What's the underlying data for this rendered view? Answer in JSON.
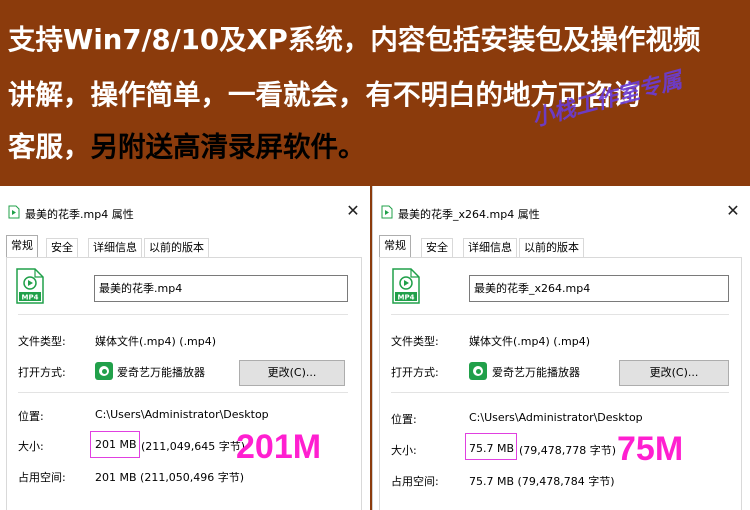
{
  "banner": {
    "line1": "支持Win7/8/10及XP系统，内容包括安装包及操作视频",
    "line2": "讲解，操作简单，一看就会，有不明白的地方可咨询",
    "line3_a": "客服，",
    "line3_b": "另附送高清录屏软件。",
    "watermark": "小栈工作室专属",
    "bg_color": "#8b3b0c"
  },
  "left_dialog": {
    "title": "最美的花季.mp4 属性",
    "close": "✕",
    "tabs": [
      "常规",
      "安全",
      "详细信息",
      "以前的版本"
    ],
    "file_name": "最美的花季.mp4",
    "file_type_label": "文件类型:",
    "file_type_value": "媒体文件(.mp4) (.mp4)",
    "open_with_label": "打开方式:",
    "open_with_value": "爱奇艺万能播放器",
    "change_button": "更改(C)...",
    "location_label": "位置:",
    "location_value": "C:\\Users\\Administrator\\Desktop",
    "size_label": "大小:",
    "size_value_hl": "201 MB",
    "size_value_rest": "(211,049,645 字节)",
    "disk_label": "占用空间:",
    "disk_value": "201 MB (211,050,496 字节)",
    "annotation": "201M"
  },
  "right_dialog": {
    "title": "最美的花季_x264.mp4 属性",
    "close": "✕",
    "tabs": [
      "常规",
      "安全",
      "详细信息",
      "以前的版本"
    ],
    "file_name": "最美的花季_x264.mp4",
    "file_type_label": "文件类型:",
    "file_type_value": "媒体文件(.mp4) (.mp4)",
    "open_with_label": "打开方式:",
    "open_with_value": "爱奇艺万能播放器",
    "change_button": "更改(C)...",
    "location_label": "位置:",
    "location_value": "C:\\Users\\Administrator\\Desktop",
    "size_label": "大小:",
    "size_value_hl": "75.7 MB",
    "size_value_rest": "(79,478,778 字节)",
    "disk_label": "占用空间:",
    "disk_value": "75.7 MB (79,478,784 字节)",
    "annotation": "75M"
  },
  "file_icon_label": "MP4",
  "colors": {
    "accent_highlight": "#ff1fd0",
    "file_icon_green": "#21a04a"
  }
}
